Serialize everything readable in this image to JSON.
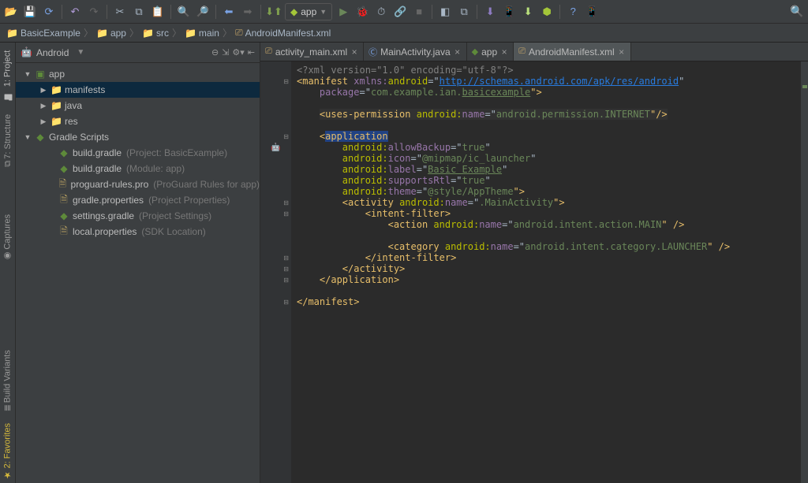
{
  "toolbar": {
    "config_label": "app"
  },
  "breadcrumbs": {
    "items": [
      {
        "icon": "folder",
        "label": "BasicExample"
      },
      {
        "icon": "folder",
        "label": "app"
      },
      {
        "icon": "folder",
        "label": "src"
      },
      {
        "icon": "folder",
        "label": "main"
      },
      {
        "icon": "xml",
        "label": "AndroidManifest.xml"
      }
    ]
  },
  "project": {
    "header": "Android",
    "tree": [
      {
        "ind": 10,
        "caret": "▼",
        "icon": "folder-app",
        "label": "app",
        "selected": false
      },
      {
        "ind": 30,
        "caret": "▶",
        "icon": "folder",
        "label": "manifests",
        "selected": true
      },
      {
        "ind": 30,
        "caret": "▶",
        "icon": "folder",
        "label": "java"
      },
      {
        "ind": 30,
        "caret": "▶",
        "icon": "folder",
        "label": "res"
      },
      {
        "ind": 10,
        "caret": "▼",
        "icon": "gradle",
        "label": "Gradle Scripts"
      },
      {
        "ind": 40,
        "caret": "",
        "icon": "file-g",
        "label": "build.gradle",
        "hint": "(Project: BasicExample)"
      },
      {
        "ind": 40,
        "caret": "",
        "icon": "file-g",
        "label": "build.gradle",
        "hint": "(Module: app)"
      },
      {
        "ind": 40,
        "caret": "",
        "icon": "file-p",
        "label": "proguard-rules.pro",
        "hint": "(ProGuard Rules for app)"
      },
      {
        "ind": 40,
        "caret": "",
        "icon": "file-p",
        "label": "gradle.properties",
        "hint": "(Project Properties)"
      },
      {
        "ind": 40,
        "caret": "",
        "icon": "file-g",
        "label": "settings.gradle",
        "hint": "(Project Settings)"
      },
      {
        "ind": 40,
        "caret": "",
        "icon": "file-p",
        "label": "local.properties",
        "hint": "(SDK Location)"
      }
    ]
  },
  "editor": {
    "tabs": [
      {
        "icon": "xml",
        "label": "activity_main.xml",
        "active": false
      },
      {
        "icon": "class",
        "label": "MainActivity.java",
        "active": false
      },
      {
        "icon": "gradle",
        "label": "app",
        "active": false
      },
      {
        "icon": "xml",
        "label": "AndroidManifest.xml",
        "active": true
      }
    ],
    "code": {
      "l1_pre": "<?",
      "l1_tag": "xml version",
      "l1_eq": "=\"",
      "l1_v1": "1.0",
      "l1_mid": "\" encoding=\"",
      "l1_v2": "utf-8",
      "l1_post": "\"?>",
      "l2_open": "<",
      "l2_tag": "manifest ",
      "l2_attr": "xmlns:",
      "l2_ns": "android",
      "l2_eq": "=\"",
      "l2_url": "http://schemas.android.com/apk/res/android",
      "l2_end": "\"",
      "l3_attr": "package",
      "l3_eq": "=\"",
      "l3_pkg_pre": "com.example.ian.",
      "l3_pkg_u": "basicexample",
      "l3_end": "\">",
      "l5_open": "<",
      "l5_tag": "uses-permission ",
      "l5_ns": "android:",
      "l5_attr": "name",
      "l5_eq": "=\"",
      "l5_val": "android.permission.INTERNET",
      "l5_end": "\"/>",
      "l7_open": "<",
      "l7_tag": "application",
      "l8_ns": "android:",
      "l8_attr": "allowBackup",
      "l8_eq": "=\"",
      "l8_val": "true",
      "l8_end": "\"",
      "l9_ns": "android:",
      "l9_attr": "icon",
      "l9_eq": "=\"",
      "l9_val": "@mipmap/ic_launcher",
      "l9_end": "\"",
      "l10_ns": "android:",
      "l10_attr": "label",
      "l10_eq": "=\"",
      "l10_val": "Basic Example",
      "l10_end": "\"",
      "l11_ns": "android:",
      "l11_attr": "supportsRtl",
      "l11_eq": "=\"",
      "l11_val": "true",
      "l11_end": "\"",
      "l12_ns": "android:",
      "l12_attr": "theme",
      "l12_eq": "=\"",
      "l12_val": "@style/AppTheme",
      "l12_end": "\">",
      "l13_open": "<",
      "l13_tag": "activity ",
      "l13_ns": "android:",
      "l13_attr": "name",
      "l13_eq": "=\"",
      "l13_val": ".MainActivity",
      "l13_end": "\">",
      "l14_open": "<",
      "l14_tag": "intent-filter",
      "l14_end": ">",
      "l15_open": "<",
      "l15_tag": "action ",
      "l15_ns": "android:",
      "l15_attr": "name",
      "l15_eq": "=\"",
      "l15_val": "android.intent.action.MAIN",
      "l15_end": "\" />",
      "l17_open": "<",
      "l17_tag": "category ",
      "l17_ns": "android:",
      "l17_attr": "name",
      "l17_eq": "=\"",
      "l17_val": "android.intent.category.LAUNCHER",
      "l17_end": "\" />",
      "l18": "</",
      "l18_tag": "intent-filter",
      "l18_end": ">",
      "l19": "</",
      "l19_tag": "activity",
      "l19_end": ">",
      "l20": "</",
      "l20_tag": "application",
      "l20_end": ">",
      "l22": "</",
      "l22_tag": "manifest",
      "l22_end": ">"
    }
  },
  "rail": {
    "items_top": [
      {
        "label": "1: Project"
      },
      {
        "label": "7: Structure"
      }
    ],
    "items_mid": [
      {
        "label": "Captures"
      }
    ],
    "items_bot": [
      {
        "label": "Build Variants"
      },
      {
        "label": "2: Favorites"
      }
    ]
  }
}
